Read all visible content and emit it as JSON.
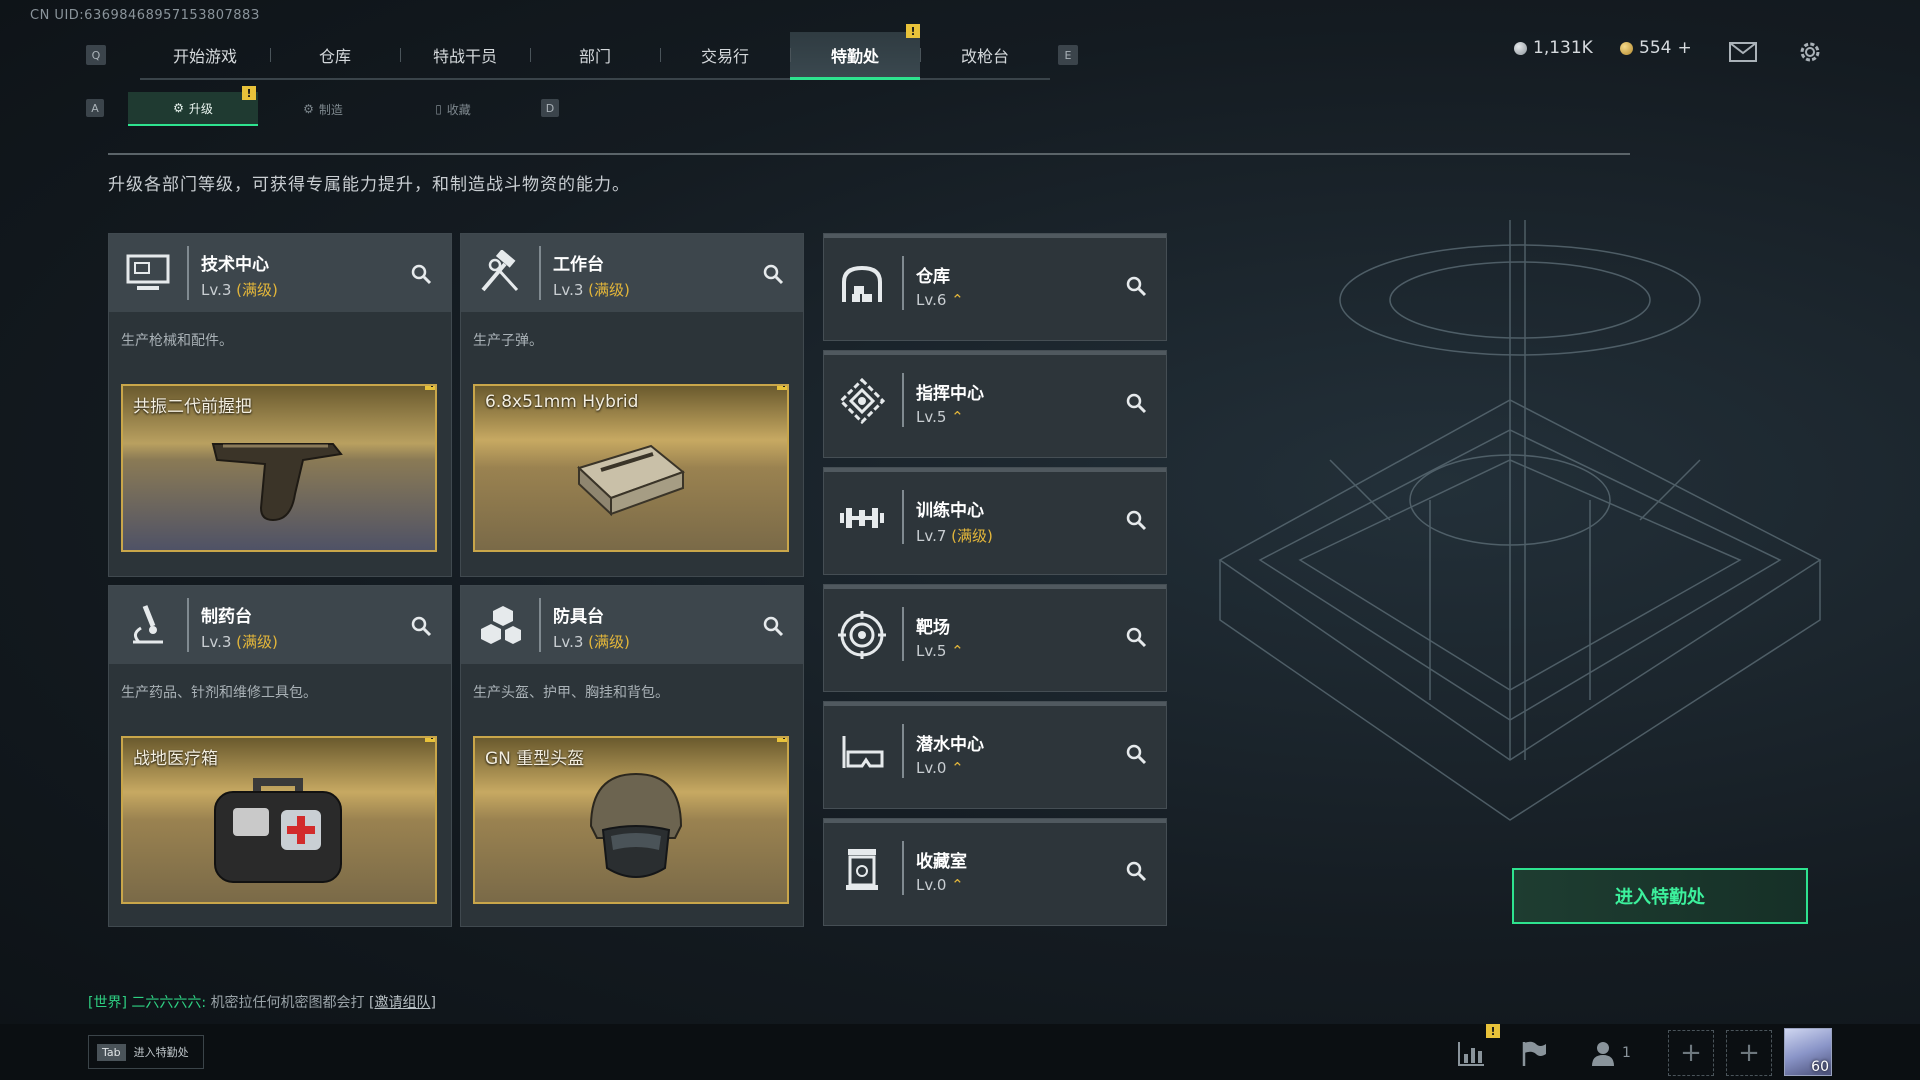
{
  "uid": "CN UID:6369846895715380788З",
  "top_nav": {
    "q_key": "Q",
    "e_key": "E",
    "tabs": [
      {
        "label": "开始游戏"
      },
      {
        "label": "仓库"
      },
      {
        "label": "特战干员"
      },
      {
        "label": "部门"
      },
      {
        "label": "交易行"
      },
      {
        "label": "特勤处",
        "active": true,
        "alert": "!"
      },
      {
        "label": "改枪台"
      }
    ]
  },
  "currency": {
    "silver": "1,131K",
    "gold": "554",
    "gold_plus": "+"
  },
  "icons": {
    "mail": "mail-icon",
    "settings": "gear-icon"
  },
  "sub_nav": {
    "a_key": "A",
    "d_key": "D",
    "tabs": [
      {
        "label": "升级",
        "active": true,
        "alert": "!"
      },
      {
        "label": "制造"
      },
      {
        "label": "收藏"
      }
    ]
  },
  "description": "升级各部门等级，可获得专属能力提升，和制造战斗物资的能力。",
  "dept_cards": [
    {
      "title": "技术中心",
      "level": "Lv.3",
      "maxed": "(满级)",
      "desc": "生产枪械和配件。",
      "product": "共振二代前握把",
      "alert": "!"
    },
    {
      "title": "工作台",
      "level": "Lv.3",
      "maxed": "(满级)",
      "desc": "生产子弹。",
      "product": "6.8x51mm Hybrid",
      "alert": "!"
    },
    {
      "title": "制药台",
      "level": "Lv.3",
      "maxed": "(满级)",
      "desc": "生产药品、针剂和维修工具包。",
      "product": "战地医疗箱",
      "alert": "!"
    },
    {
      "title": "防具台",
      "level": "Lv.3",
      "maxed": "(满级)",
      "desc": "生产头盔、护甲、胸挂和背包。",
      "product": "GN 重型头盔",
      "alert": "!"
    }
  ],
  "buildings": [
    {
      "title": "仓库",
      "level": "Lv.6",
      "upgrade": "⌃"
    },
    {
      "title": "指挥中心",
      "level": "Lv.5",
      "upgrade": "⌃"
    },
    {
      "title": "训练中心",
      "level": "Lv.7",
      "maxed": "(满级)"
    },
    {
      "title": "靶场",
      "level": "Lv.5",
      "upgrade": "⌃"
    },
    {
      "title": "潜水中心",
      "level": "Lv.0",
      "upgrade": "⌃"
    },
    {
      "title": "收藏室",
      "level": "Lv.0",
      "upgrade": "⌃"
    }
  ],
  "enter_button": "进入特勤处",
  "chat": {
    "channel": "[世界]",
    "sender": "二六六六六:",
    "message": "机密拉任何机密图都会打",
    "link": "[邀请组队]"
  },
  "bottom": {
    "tab_key": "Tab",
    "tab_label": "进入特勤处",
    "friends_count": "1",
    "alert": "!",
    "level": "60"
  },
  "colors": {
    "accent": "#2ee38f",
    "gold": "#e3b63a",
    "alert": "#e8c23a"
  }
}
